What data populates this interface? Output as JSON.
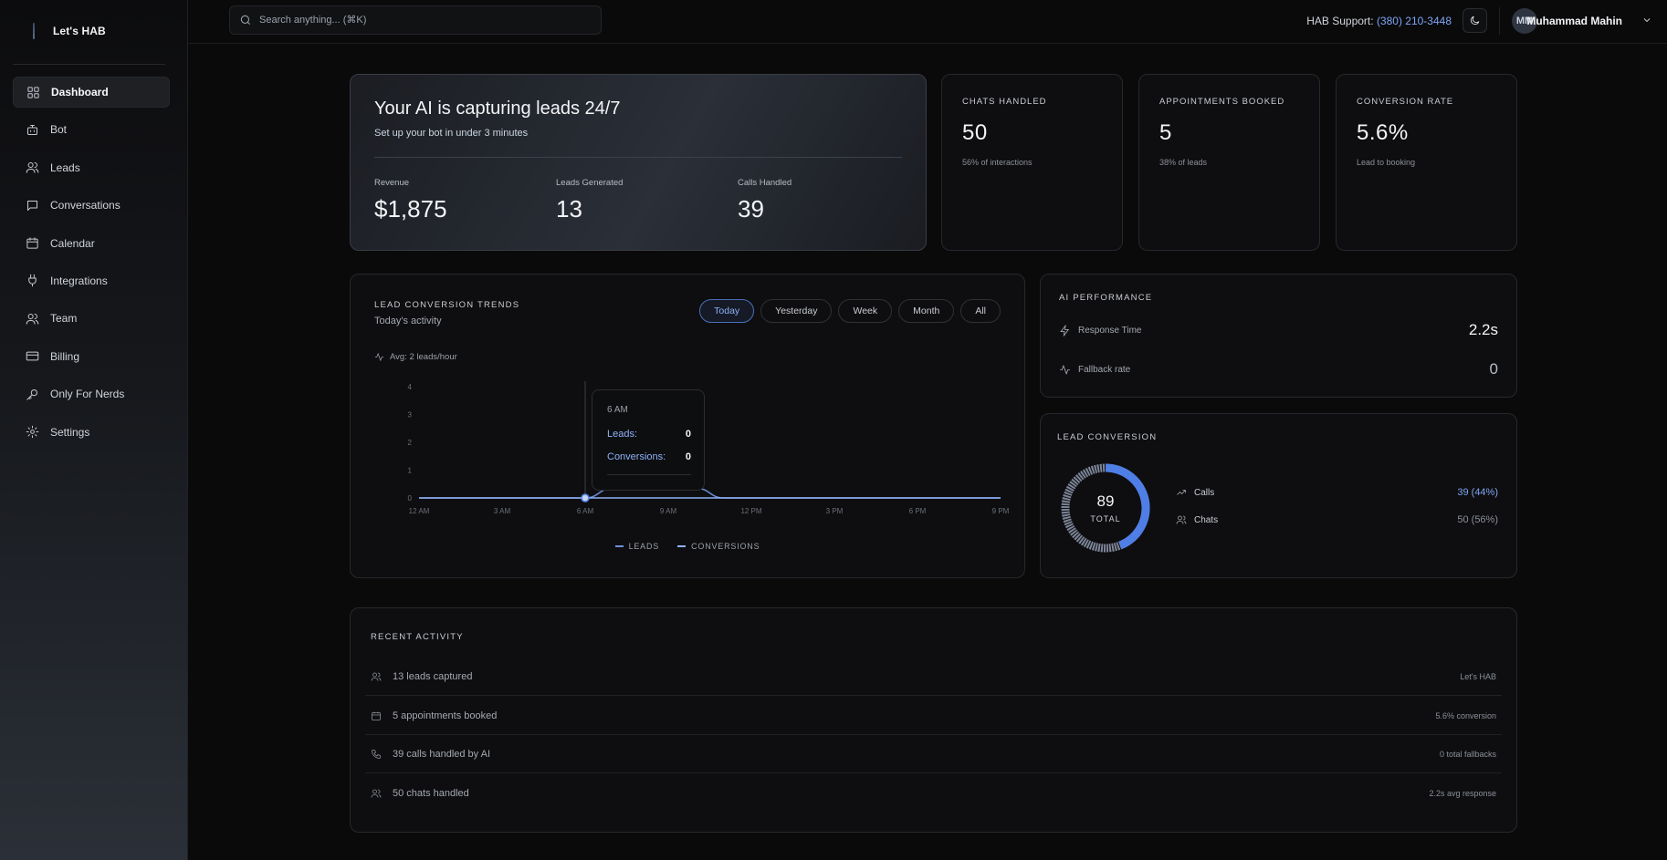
{
  "brand": {
    "name": "Let's HAB"
  },
  "sidebar": {
    "items": [
      {
        "label": "Dashboard",
        "icon": "grid-icon",
        "active": true
      },
      {
        "label": "Bot",
        "icon": "bot-icon"
      },
      {
        "label": "Leads",
        "icon": "users-icon"
      },
      {
        "label": "Conversations",
        "icon": "message-icon"
      },
      {
        "label": "Calendar",
        "icon": "calendar-icon"
      },
      {
        "label": "Integrations",
        "icon": "plug-icon"
      },
      {
        "label": "Team",
        "icon": "team-icon"
      },
      {
        "label": "Billing",
        "icon": "card-icon"
      },
      {
        "label": "Only For Nerds",
        "icon": "key-icon"
      },
      {
        "label": "Settings",
        "icon": "gear-icon"
      }
    ]
  },
  "topbar": {
    "search_placeholder": "Search anything... (⌘K)",
    "support_label": "HAB Support:",
    "support_phone": "(380) 210-3448",
    "user_initials": "MM",
    "user_name": "Muhammad Mahin"
  },
  "hero": {
    "title": "Your AI is capturing leads 24/7",
    "subtitle": "Set up your bot in under 3 minutes",
    "stats": [
      {
        "label": "Revenue",
        "value": "$1,875"
      },
      {
        "label": "Leads Generated",
        "value": "13"
      },
      {
        "label": "Calls Handled",
        "value": "39"
      }
    ]
  },
  "kpis": [
    {
      "label": "CHATS HANDLED",
      "value": "50",
      "sub": "56% of interactions"
    },
    {
      "label": "APPOINTMENTS BOOKED",
      "value": "5",
      "sub": "38% of leads"
    },
    {
      "label": "CONVERSION RATE",
      "value": "5.6%",
      "sub": "Lead to booking"
    }
  ],
  "trends": {
    "title": "LEAD CONVERSION TRENDS",
    "subtitle": "Today's activity",
    "filters": [
      "Today",
      "Yesterday",
      "Week",
      "Month",
      "All"
    ],
    "active_filter": "Today",
    "avg": "Avg: 2 leads/hour",
    "legend": [
      "LEADS",
      "CONVERSIONS"
    ],
    "tooltip": {
      "time": "6 AM",
      "leads_label": "Leads:",
      "leads_value": "0",
      "conv_label": "Conversions:",
      "conv_value": "0"
    }
  },
  "chart_data": {
    "type": "line",
    "x": [
      "12 AM",
      "1 AM",
      "2 AM",
      "3 AM",
      "4 AM",
      "5 AM",
      "6 AM",
      "7 AM",
      "8 AM",
      "9 AM",
      "10 AM",
      "11 AM",
      "12 PM",
      "1 PM",
      "2 PM",
      "3 PM",
      "4 PM",
      "5 PM",
      "6 PM",
      "7 PM",
      "8 PM",
      "9 PM"
    ],
    "xticks": [
      "12 AM",
      "3 AM",
      "6 AM",
      "9 AM",
      "12 PM",
      "3 PM",
      "6 PM",
      "9 PM"
    ],
    "yticks": [
      0,
      1,
      2,
      3,
      4
    ],
    "ylim": [
      0,
      4
    ],
    "series": [
      {
        "name": "LEADS",
        "values": [
          0,
          0,
          0,
          0,
          0,
          0,
          0,
          0.35,
          1.2,
          1.25,
          0.35,
          0,
          0,
          0,
          0,
          0,
          0,
          0,
          0,
          0,
          0,
          0
        ],
        "color": "#6d8fd9"
      },
      {
        "name": "CONVERSIONS",
        "values": [
          0,
          0,
          0,
          0,
          0,
          0,
          0,
          0,
          0,
          0,
          0,
          0,
          0,
          0,
          0,
          0,
          0,
          0,
          0,
          0,
          0,
          0
        ],
        "color": "#8fb2f7"
      }
    ],
    "highlight_x": "6 AM",
    "grid": false
  },
  "ai_performance": {
    "title": "AI PERFORMANCE",
    "metrics": [
      {
        "label": "Response Time",
        "value": "2.2s",
        "icon": "zap-icon"
      },
      {
        "label": "Fallback rate",
        "value": "0",
        "icon": "activity-icon"
      }
    ]
  },
  "lead_conversion": {
    "title": "LEAD CONVERSION",
    "total": "89",
    "total_label": "TOTAL",
    "rows": [
      {
        "label": "Calls",
        "value": "39 (44%)",
        "icon": "trend-icon"
      },
      {
        "label": "Chats",
        "value": "50 (56%)",
        "icon": "users-icon"
      }
    ],
    "calls_fraction": 0.44,
    "colors": {
      "calls": "#4f7fe6",
      "chats": "#7c8598"
    }
  },
  "recent_activity": {
    "title": "RECENT ACTIVITY",
    "rows": [
      {
        "label": "13 leads captured",
        "meta": "Let's HAB",
        "icon": "users-icon"
      },
      {
        "label": "5 appointments booked",
        "meta": "5.6% conversion",
        "icon": "calendar-icon"
      },
      {
        "label": "39 calls handled by AI",
        "meta": "0 total fallbacks",
        "icon": "phone-icon"
      },
      {
        "label": "50 chats handled",
        "meta": "2.2s avg response",
        "icon": "users-icon"
      }
    ]
  }
}
